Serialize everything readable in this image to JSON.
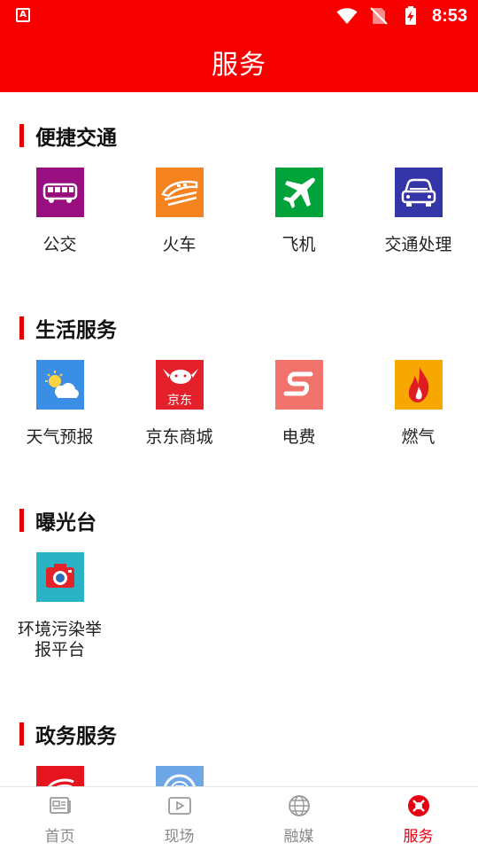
{
  "statusbar": {
    "time": "8:53",
    "app_icon_letter": "A"
  },
  "page_title": "服务",
  "sections": [
    {
      "title": "便捷交通",
      "items": [
        {
          "label": "公交",
          "icon": "bus-icon",
          "color": "#990f7f"
        },
        {
          "label": "火车",
          "icon": "train-icon",
          "color": "#f5831f"
        },
        {
          "label": "飞机",
          "icon": "airplane-icon",
          "color": "#00a23a"
        },
        {
          "label": "交通处理",
          "icon": "car-icon",
          "color": "#3436a8"
        }
      ]
    },
    {
      "title": "生活服务",
      "items": [
        {
          "label": "天气预报",
          "icon": "weather-icon",
          "color": "#3a8ee6"
        },
        {
          "label": "京东商城",
          "icon": "jd-icon",
          "color": "#e4212b",
          "icon_text": "京东"
        },
        {
          "label": "电费",
          "icon": "electricity-icon",
          "color": "#f2726c"
        },
        {
          "label": "燃气",
          "icon": "flame-icon",
          "color": "#f7a800"
        }
      ]
    },
    {
      "title": "曝光台",
      "items": [
        {
          "label": "环境污染举报平台",
          "icon": "camera-icon",
          "color": "#2ab3c4"
        }
      ]
    },
    {
      "title": "政务服务",
      "items": [
        {
          "label": "",
          "icon": "gov-red-icon",
          "color": "#e4151f"
        },
        {
          "label": "",
          "icon": "gov-blue-icon",
          "color": "#6ea7e8"
        }
      ]
    }
  ],
  "bottom_nav": [
    {
      "label": "首页",
      "icon": "newspaper-icon",
      "active": false
    },
    {
      "label": "现场",
      "icon": "video-icon",
      "active": false
    },
    {
      "label": "融媒",
      "icon": "globe-icon",
      "active": false
    },
    {
      "label": "服务",
      "icon": "service-icon",
      "active": true
    }
  ],
  "colors": {
    "primary": "#f70000",
    "accent": "#e60012",
    "inactive": "#888888"
  }
}
